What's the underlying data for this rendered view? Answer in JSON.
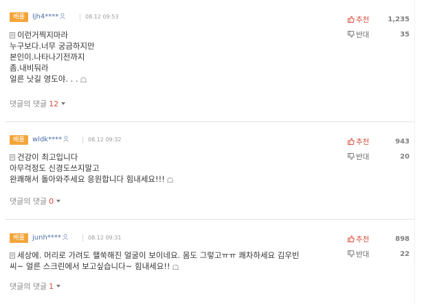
{
  "colors": {
    "best_badge": "#f3a53a",
    "recommend": "#d94c3a",
    "userid": "#4a6ea7"
  },
  "icons": {
    "user": "user-icon",
    "thumbs_up": "thumbs-up-icon",
    "thumbs_down": "thumbs-down-icon",
    "document": "document-icon",
    "report": "report-icon",
    "caret": "caret-down-icon"
  },
  "comments": [
    {
      "badge": "베플",
      "user": "ljh4****",
      "date": "08.12 09:53",
      "recommend_label": "추천",
      "recommend_count": "1,235",
      "oppose_label": "반대",
      "oppose_count": "35",
      "lines": [
        "이런거찍지마라",
        "누구보다.너무 궁금하지만",
        "본인이.나타나기전까지",
        "좀.내비둬라",
        "얼른 낫길 영도야. . ."
      ],
      "replies_label": "댓글의 댓글",
      "replies_count": "12"
    },
    {
      "badge": "베플",
      "user": "wldk****",
      "date": "08.12 09:32",
      "recommend_label": "추천",
      "recommend_count": "943",
      "oppose_label": "반대",
      "oppose_count": "20",
      "lines": [
        "건강이 최고입니다",
        "아무걱정도 신경도쓰지말고",
        "완쾌해서 돌아와주세요 응원합니다 힘내세요!!!"
      ],
      "replies_label": "댓글의 댓글",
      "replies_count": "0"
    },
    {
      "badge": "베플",
      "user": "junh****",
      "date": "08.12 09:31",
      "recommend_label": "추천",
      "recommend_count": "898",
      "oppose_label": "반대",
      "oppose_count": "22",
      "lines": [
        "세상에. 머리로 가려도 핼쑥해진 얼굴이 보이네요. 몸도 그렇고ㅠㅠ 쾌차하세요 김우빈",
        "씨~ 얼른 스크린에서 보고싶습니다~ 힘내세요!!"
      ],
      "replies_label": "댓글의 댓글",
      "replies_count": "1"
    }
  ]
}
